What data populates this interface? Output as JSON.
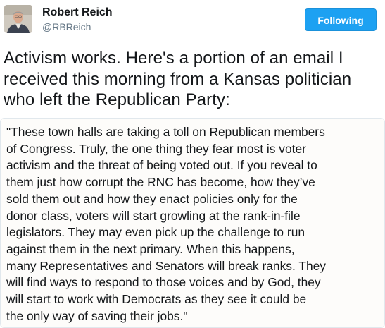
{
  "author": {
    "name": "Robert Reich",
    "handle": "@RBReich",
    "avatar_icon": "profile-photo"
  },
  "follow_button": {
    "label": "Following",
    "color": "#1da1f2"
  },
  "tweet": {
    "lines": [
      "Activism works. Here's a portion of an email I",
      "received this morning from a Kansas politician",
      "who left the Republican Party:"
    ]
  },
  "quote": {
    "lines": [
      "\"These town halls are taking a toll on Republican members",
      "of Congress. Truly, the one thing they fear most is voter",
      "activism and the threat of being voted out. If you reveal to",
      "them just how corrupt the RNC has become, how they’ve",
      "sold them out and how they enact policies only for the",
      "donor class, voters will start growling at the rank-in-file",
      "legislators. They may even pick up the challenge to run",
      "against them in the next primary. When this happens,",
      "many Representatives and Senators will break ranks. They",
      "will find ways to respond to those voices and by God, they",
      "will start to work with Democrats as they see it could be",
      "the only way of saving their jobs.\""
    ]
  }
}
